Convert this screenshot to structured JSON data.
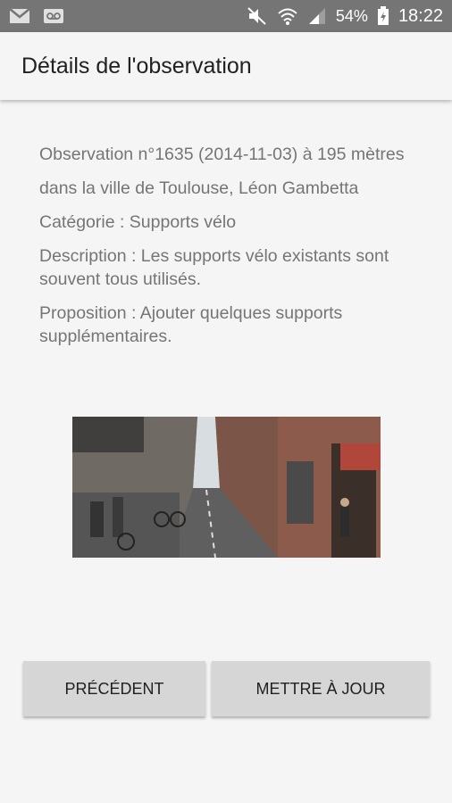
{
  "status_bar": {
    "battery": "54%",
    "time": "18:22"
  },
  "app_bar": {
    "title": "Détails de l'observation"
  },
  "details": {
    "observation": "Observation n°1635 (2014-11-03) à 195 mètres",
    "city": "dans la ville de Toulouse, Léon Gambetta",
    "category": "Catégorie : Supports vélo",
    "description": "Description : Les supports vélo existants sont souvent tous utilisés.",
    "proposition": "Proposition : Ajouter quelques supports supplémentaires."
  },
  "buttons": {
    "previous": "PRÉCÉDENT",
    "update": "METTRE À JOUR"
  }
}
